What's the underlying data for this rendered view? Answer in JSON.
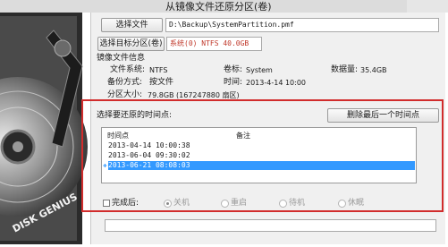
{
  "window": {
    "title": "从镜像文件还原分区(卷)"
  },
  "image_file": {
    "button": "选择文件",
    "path": "D:\\Backup\\SystemPartition.pmf"
  },
  "target_partition": {
    "button": "选择目标分区(卷)",
    "value": "系统(0) NTFS 40.0GB"
  },
  "image_info": {
    "heading": "镜像文件信息",
    "fs_label": "文件系统:",
    "fs_value": "NTFS",
    "vol_label": "卷标:",
    "vol_value": "System",
    "count_label": "数据量:",
    "count_value": "35.4GB",
    "method_label": "备份方式:",
    "method_value": "按文件",
    "time_label": "时间:",
    "time_value": "2013-4-14 10:00",
    "size_label": "分区大小:",
    "size_value": "79.8GB (167247880 扇区)"
  },
  "restore_points": {
    "label": "选择要还原的时间点:",
    "delete_button": "删除最后一个时间点",
    "col_time": "时间点",
    "col_note": "备注",
    "rows": [
      {
        "time": "2013-04-14 10:00:38",
        "selected": false
      },
      {
        "time": "2013-06-04 09:30:02",
        "selected": false
      },
      {
        "time": "2013-06-21 08:08:03",
        "selected": true
      }
    ]
  },
  "after_complete": {
    "label": "完成后:",
    "options": [
      "关机",
      "重启",
      "待机",
      "休眠"
    ],
    "selected_index": 0
  },
  "brand": {
    "logo_text": "DISK GENIUS"
  },
  "colors": {
    "highlight": "#d12c2c",
    "selection": "#3399ff"
  }
}
